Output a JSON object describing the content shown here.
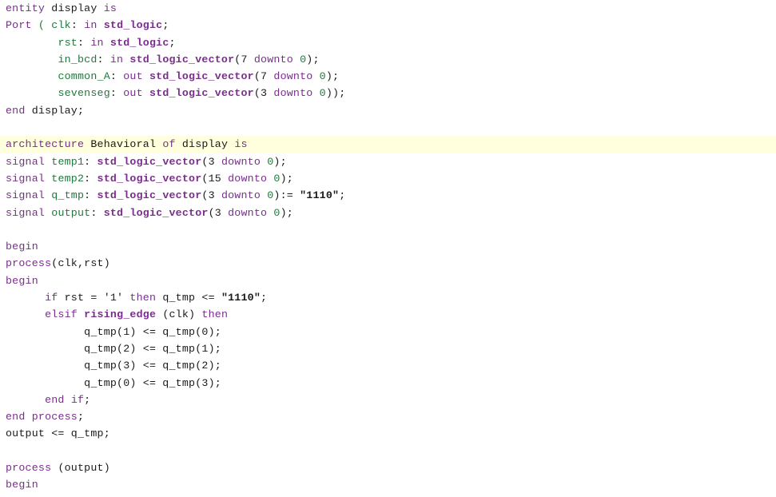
{
  "editor": {
    "language": "VHDL",
    "background_color": "#ffffff",
    "highlight_color": "#ffffdd",
    "colors": {
      "keyword": "#7b2d8e",
      "type": "#7b2d8e",
      "identifier": "#1f7a3d",
      "plain": "#1a1a1a",
      "string": "#1a1a1a"
    }
  },
  "lines": [
    {
      "indent": 0,
      "highlight": false,
      "tokens": [
        {
          "t": "entity",
          "c": "kw"
        },
        {
          "t": " ",
          "c": "plain"
        },
        {
          "t": "display",
          "c": "plain"
        },
        {
          "t": " ",
          "c": "plain"
        },
        {
          "t": "is",
          "c": "kw"
        }
      ]
    },
    {
      "indent": 0,
      "highlight": false,
      "tokens": [
        {
          "t": "Port",
          "c": "kw"
        },
        {
          "t": " ",
          "c": "plain"
        },
        {
          "t": "(",
          "c": "id"
        },
        {
          "t": " ",
          "c": "plain"
        },
        {
          "t": "clk",
          "c": "id"
        },
        {
          "t": ": ",
          "c": "plain"
        },
        {
          "t": "in",
          "c": "kw"
        },
        {
          "t": " ",
          "c": "plain"
        },
        {
          "t": "std_logic",
          "c": "type"
        },
        {
          "t": ";",
          "c": "plain"
        }
      ]
    },
    {
      "indent": 4,
      "highlight": false,
      "tokens": [
        {
          "t": "rst",
          "c": "id"
        },
        {
          "t": ": ",
          "c": "plain"
        },
        {
          "t": "in",
          "c": "kw"
        },
        {
          "t": " ",
          "c": "plain"
        },
        {
          "t": "std_logic",
          "c": "type"
        },
        {
          "t": ";",
          "c": "plain"
        }
      ]
    },
    {
      "indent": 4,
      "highlight": false,
      "tokens": [
        {
          "t": "in_bcd",
          "c": "id"
        },
        {
          "t": ": ",
          "c": "plain"
        },
        {
          "t": "in",
          "c": "kw"
        },
        {
          "t": " ",
          "c": "plain"
        },
        {
          "t": "std_logic_vector",
          "c": "type"
        },
        {
          "t": "(7 ",
          "c": "plain"
        },
        {
          "t": "downto",
          "c": "kw"
        },
        {
          "t": " ",
          "c": "plain"
        },
        {
          "t": "0",
          "c": "num"
        },
        {
          "t": ");",
          "c": "plain"
        }
      ]
    },
    {
      "indent": 4,
      "highlight": false,
      "tokens": [
        {
          "t": "common_A",
          "c": "id"
        },
        {
          "t": ": ",
          "c": "plain"
        },
        {
          "t": "out",
          "c": "kw"
        },
        {
          "t": " ",
          "c": "plain"
        },
        {
          "t": "std_logic_vector",
          "c": "type"
        },
        {
          "t": "(7 ",
          "c": "plain"
        },
        {
          "t": "downto",
          "c": "kw"
        },
        {
          "t": " ",
          "c": "plain"
        },
        {
          "t": "0",
          "c": "num"
        },
        {
          "t": ");",
          "c": "plain"
        }
      ]
    },
    {
      "indent": 4,
      "highlight": false,
      "tokens": [
        {
          "t": "sevenseg",
          "c": "id"
        },
        {
          "t": ": ",
          "c": "plain"
        },
        {
          "t": "out",
          "c": "kw"
        },
        {
          "t": " ",
          "c": "plain"
        },
        {
          "t": "std_logic_vector",
          "c": "type"
        },
        {
          "t": "(3 ",
          "c": "plain"
        },
        {
          "t": "downto",
          "c": "kw"
        },
        {
          "t": " ",
          "c": "plain"
        },
        {
          "t": "0",
          "c": "num"
        },
        {
          "t": "));",
          "c": "plain"
        }
      ]
    },
    {
      "indent": 0,
      "highlight": false,
      "tokens": [
        {
          "t": "end",
          "c": "kw"
        },
        {
          "t": " ",
          "c": "plain"
        },
        {
          "t": "display",
          "c": "plain"
        },
        {
          "t": ";",
          "c": "plain"
        }
      ]
    },
    {
      "indent": 0,
      "highlight": false,
      "blank": true,
      "tokens": []
    },
    {
      "indent": 0,
      "highlight": true,
      "tokens": [
        {
          "t": "architecture",
          "c": "kw"
        },
        {
          "t": " ",
          "c": "plain"
        },
        {
          "t": "Behavioral",
          "c": "plain"
        },
        {
          "t": " ",
          "c": "plain"
        },
        {
          "t": "of",
          "c": "kw"
        },
        {
          "t": " ",
          "c": "plain"
        },
        {
          "t": "display",
          "c": "plain"
        },
        {
          "t": " ",
          "c": "plain"
        },
        {
          "t": "is",
          "c": "kw"
        }
      ]
    },
    {
      "indent": 0,
      "highlight": false,
      "tokens": [
        {
          "t": "signal",
          "c": "kw"
        },
        {
          "t": " ",
          "c": "plain"
        },
        {
          "t": "temp1",
          "c": "id"
        },
        {
          "t": ": ",
          "c": "plain"
        },
        {
          "t": "std_logic_vector",
          "c": "type"
        },
        {
          "t": "(3 ",
          "c": "plain"
        },
        {
          "t": "downto",
          "c": "kw"
        },
        {
          "t": " ",
          "c": "plain"
        },
        {
          "t": "0",
          "c": "num"
        },
        {
          "t": ");",
          "c": "plain"
        }
      ]
    },
    {
      "indent": 0,
      "highlight": false,
      "tokens": [
        {
          "t": "signal",
          "c": "kw"
        },
        {
          "t": " ",
          "c": "plain"
        },
        {
          "t": "temp2",
          "c": "id"
        },
        {
          "t": ": ",
          "c": "plain"
        },
        {
          "t": "std_logic_vector",
          "c": "type"
        },
        {
          "t": "(15 ",
          "c": "plain"
        },
        {
          "t": "downto",
          "c": "kw"
        },
        {
          "t": " ",
          "c": "plain"
        },
        {
          "t": "0",
          "c": "num"
        },
        {
          "t": ");",
          "c": "plain"
        }
      ]
    },
    {
      "indent": 0,
      "highlight": false,
      "tokens": [
        {
          "t": "signal",
          "c": "kw"
        },
        {
          "t": " ",
          "c": "plain"
        },
        {
          "t": "q_tmp",
          "c": "id"
        },
        {
          "t": ": ",
          "c": "plain"
        },
        {
          "t": "std_logic_vector",
          "c": "type"
        },
        {
          "t": "(3 ",
          "c": "plain"
        },
        {
          "t": "downto",
          "c": "kw"
        },
        {
          "t": " ",
          "c": "plain"
        },
        {
          "t": "0",
          "c": "num"
        },
        {
          "t": "):= ",
          "c": "plain"
        },
        {
          "t": "\"1110\"",
          "c": "str"
        },
        {
          "t": ";",
          "c": "plain"
        }
      ]
    },
    {
      "indent": 0,
      "highlight": false,
      "tokens": [
        {
          "t": "signal",
          "c": "kw"
        },
        {
          "t": " ",
          "c": "plain"
        },
        {
          "t": "output",
          "c": "id"
        },
        {
          "t": ": ",
          "c": "plain"
        },
        {
          "t": "std_logic_vector",
          "c": "type"
        },
        {
          "t": "(3 ",
          "c": "plain"
        },
        {
          "t": "downto",
          "c": "kw"
        },
        {
          "t": " ",
          "c": "plain"
        },
        {
          "t": "0",
          "c": "num"
        },
        {
          "t": ");",
          "c": "plain"
        }
      ]
    },
    {
      "indent": 0,
      "highlight": false,
      "blank": true,
      "tokens": []
    },
    {
      "indent": 0,
      "highlight": false,
      "tokens": [
        {
          "t": "begin",
          "c": "kw"
        }
      ]
    },
    {
      "indent": 0,
      "highlight": false,
      "tokens": [
        {
          "t": "process",
          "c": "kw"
        },
        {
          "t": "(clk,rst)",
          "c": "plain"
        }
      ]
    },
    {
      "indent": 0,
      "highlight": false,
      "tokens": [
        {
          "t": "begin",
          "c": "kw"
        }
      ]
    },
    {
      "indent": 3,
      "highlight": false,
      "tokens": [
        {
          "t": "if",
          "c": "kw"
        },
        {
          "t": " rst = '1' ",
          "c": "plain"
        },
        {
          "t": "then",
          "c": "kw"
        },
        {
          "t": " q_tmp <= ",
          "c": "plain"
        },
        {
          "t": "\"1110\"",
          "c": "str"
        },
        {
          "t": ";",
          "c": "plain"
        }
      ]
    },
    {
      "indent": 3,
      "highlight": false,
      "tokens": [
        {
          "t": "elsif",
          "c": "kw"
        },
        {
          "t": " ",
          "c": "plain"
        },
        {
          "t": "rising_edge",
          "c": "type"
        },
        {
          "t": " (clk) ",
          "c": "plain"
        },
        {
          "t": "then",
          "c": "kw"
        }
      ]
    },
    {
      "indent": 6,
      "highlight": false,
      "tokens": [
        {
          "t": "q_tmp(1) <= q_tmp(0);",
          "c": "plain"
        }
      ]
    },
    {
      "indent": 6,
      "highlight": false,
      "tokens": [
        {
          "t": "q_tmp(2) <= q_tmp(1);",
          "c": "plain"
        }
      ]
    },
    {
      "indent": 6,
      "highlight": false,
      "tokens": [
        {
          "t": "q_tmp(3) <= q_tmp(2);",
          "c": "plain"
        }
      ]
    },
    {
      "indent": 6,
      "highlight": false,
      "tokens": [
        {
          "t": "q_tmp(0) <= q_tmp(3);",
          "c": "plain"
        }
      ]
    },
    {
      "indent": 3,
      "highlight": false,
      "tokens": [
        {
          "t": "end",
          "c": "kw"
        },
        {
          "t": " ",
          "c": "plain"
        },
        {
          "t": "if",
          "c": "kw"
        },
        {
          "t": ";",
          "c": "plain"
        }
      ]
    },
    {
      "indent": 0,
      "highlight": false,
      "tokens": [
        {
          "t": "end",
          "c": "kw"
        },
        {
          "t": " ",
          "c": "plain"
        },
        {
          "t": "process",
          "c": "kw"
        },
        {
          "t": ";",
          "c": "plain"
        }
      ]
    },
    {
      "indent": 0,
      "highlight": false,
      "tokens": [
        {
          "t": "output <= q_tmp;",
          "c": "plain"
        }
      ]
    },
    {
      "indent": 0,
      "highlight": false,
      "blank": true,
      "tokens": []
    },
    {
      "indent": 0,
      "highlight": false,
      "tokens": [
        {
          "t": "process",
          "c": "kw"
        },
        {
          "t": " (output)",
          "c": "plain"
        }
      ]
    },
    {
      "indent": 0,
      "highlight": false,
      "tokens": [
        {
          "t": "begin",
          "c": "kw"
        }
      ]
    }
  ]
}
